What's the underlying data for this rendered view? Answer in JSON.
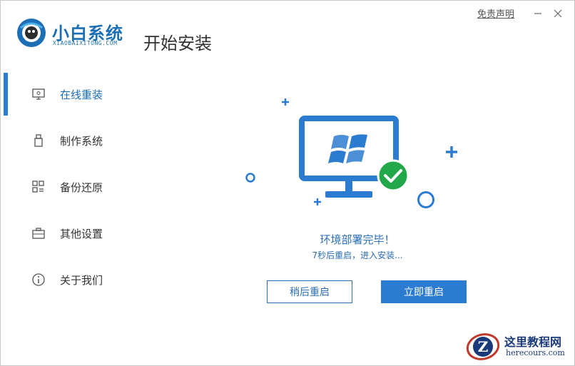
{
  "app": {
    "brand_name": "小白系统",
    "brand_sub": "XIAOBAIXITONG.COM",
    "page_title": "开始安装"
  },
  "window_controls": {
    "disclaimer": "免责声明",
    "minimize_icon": "minimize-icon",
    "close_icon": "close-icon"
  },
  "sidebar": {
    "items": [
      {
        "label": "在线重装",
        "icon": "monitor-icon",
        "active": true
      },
      {
        "label": "制作系统",
        "icon": "usb-icon",
        "active": false
      },
      {
        "label": "备份还原",
        "icon": "grid-icon",
        "active": false
      },
      {
        "label": "其他设置",
        "icon": "briefcase-icon",
        "active": false
      },
      {
        "label": "关于我们",
        "icon": "info-icon",
        "active": false
      }
    ]
  },
  "main": {
    "status_title": "环境部署完毕！",
    "status_sub": "7秒后重启，进入安装...",
    "btn_later": "稍后重启",
    "btn_now": "立即重启"
  },
  "watermark": {
    "text1": "这里教程网",
    "text2": "herecours.com"
  },
  "colors": {
    "accent": "#2b7bd0",
    "brand": "#1c6fb5",
    "success": "#22a84a"
  }
}
